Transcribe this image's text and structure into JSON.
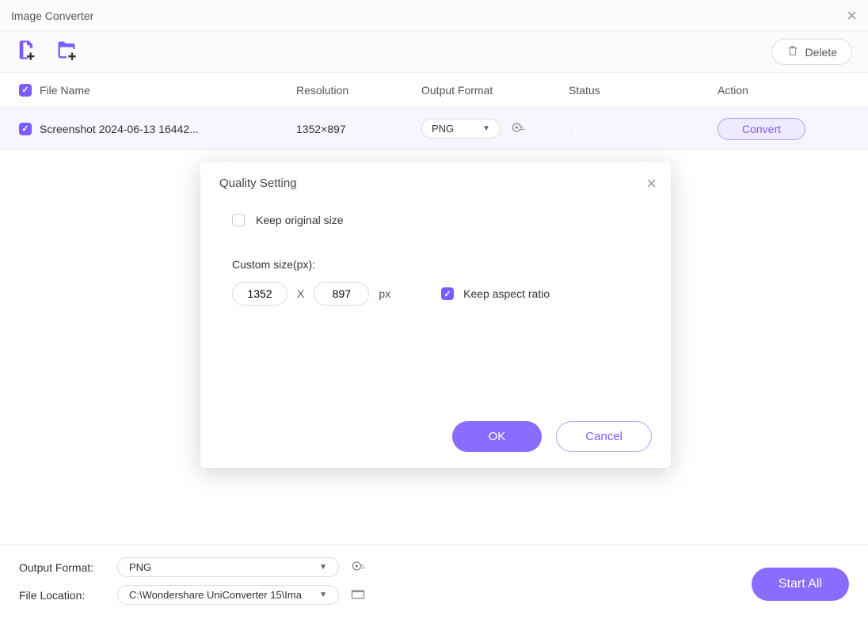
{
  "window": {
    "title": "Image Converter"
  },
  "toolbar": {
    "delete_label": "Delete"
  },
  "columns": {
    "file": "File Name",
    "resolution": "Resolution",
    "format": "Output Format",
    "status": "Status",
    "action": "Action"
  },
  "row": {
    "filename": "Screenshot 2024-06-13 16442...",
    "resolution": "1352×897",
    "format": "PNG",
    "convert_label": "Convert"
  },
  "dialog": {
    "title": "Quality Setting",
    "keep_original": "Keep original size",
    "custom_size_label": "Custom size(px):",
    "width": "1352",
    "height": "897",
    "x": "X",
    "px": "px",
    "keep_ratio": "Keep aspect ratio",
    "ok": "OK",
    "cancel": "Cancel"
  },
  "footer": {
    "output_label": "Output Format:",
    "output_value": "PNG",
    "location_label": "File Location:",
    "location_value": "C:\\Wondershare UniConverter 15\\Ima",
    "start_all": "Start All"
  }
}
